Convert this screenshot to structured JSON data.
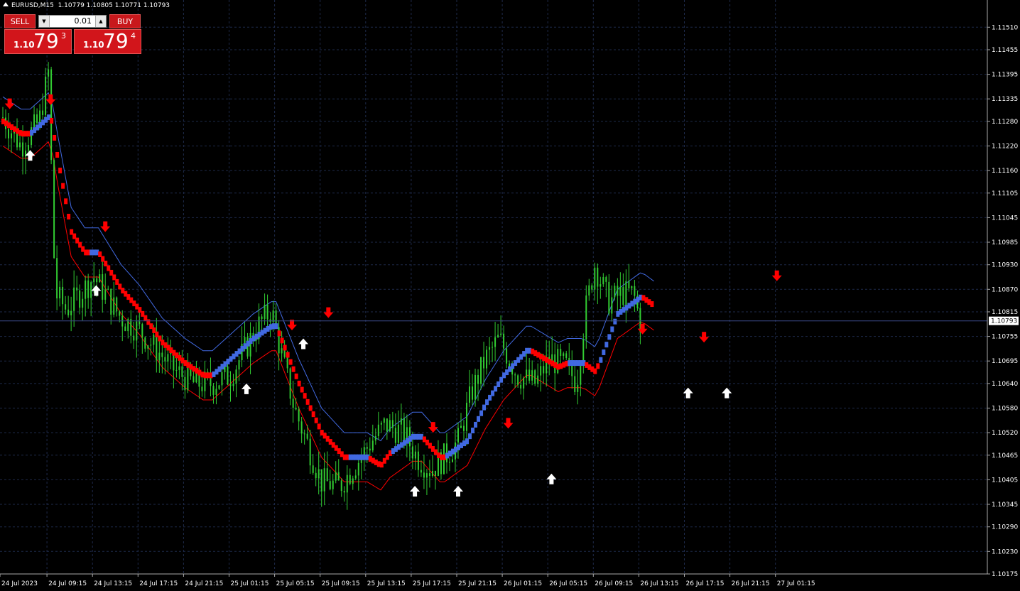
{
  "chart_header": {
    "symbol_text": "EURUSD,M15",
    "ohlc_text": "1.10779 1.10805 1.10771 1.10793"
  },
  "trade_panel": {
    "sell_label": "SELL",
    "buy_label": "BUY",
    "lot_value": "0.01",
    "sell_price": {
      "small": "1.10",
      "big": "79",
      "sup": "3"
    },
    "buy_price": {
      "small": "1.10",
      "big": "79",
      "sup": "4"
    }
  },
  "current_price_label": "1.10793",
  "colors": {
    "background": "#000000",
    "grid": "#1e2a4a",
    "candle": "#32cd32",
    "trend_up": "#4169e1",
    "trend_down": "#ff0000",
    "envelope_upper": "#4169e1",
    "envelope_lower": "#ff0000",
    "arrow_buy": "#ffffff",
    "arrow_sell": "#ff0000",
    "panel_red": "#c8181c"
  },
  "chart_data": {
    "type": "line",
    "symbol": "EURUSD",
    "timeframe": "M15",
    "ylim": [
      1.10175,
      1.1154
    ],
    "y_ticks": [
      "1.11510",
      "1.11455",
      "1.11395",
      "1.11335",
      "1.11280",
      "1.11220",
      "1.11160",
      "1.11105",
      "1.11045",
      "1.10985",
      "1.10930",
      "1.10870",
      "1.10815",
      "1.10755",
      "1.10695",
      "1.10640",
      "1.10580",
      "1.10520",
      "1.10465",
      "1.10405",
      "1.10345",
      "1.10290",
      "1.10230",
      "1.10175"
    ],
    "x_ticks": [
      "24 Jul 2023",
      "24 Jul 09:15",
      "24 Jul 13:15",
      "24 Jul 17:15",
      "24 Jul 21:15",
      "25 Jul 01:15",
      "25 Jul 05:15",
      "25 Jul 09:15",
      "25 Jul 13:15",
      "25 Jul 17:15",
      "25 Jul 21:15",
      "26 Jul 01:15",
      "26 Jul 05:15",
      "26 Jul 09:15",
      "26 Jul 13:15",
      "26 Jul 17:15",
      "26 Jul 21:15",
      "27 Jul 01:15"
    ],
    "current_price": 1.10793,
    "price_path": [
      [
        0,
        1.1129
      ],
      [
        0.4,
        1.1122
      ],
      [
        0.8,
        1.1128
      ],
      [
        1.0,
        1.114
      ],
      [
        1.15,
        1.1086
      ],
      [
        1.4,
        1.1082
      ],
      [
        1.7,
        1.1086
      ],
      [
        2.0,
        1.109
      ],
      [
        2.3,
        1.1085
      ],
      [
        2.6,
        1.108
      ],
      [
        3.0,
        1.1077
      ],
      [
        3.4,
        1.1072
      ],
      [
        3.8,
        1.1067
      ],
      [
        4.2,
        1.1064
      ],
      [
        4.6,
        1.1064
      ],
      [
        5.0,
        1.1066
      ],
      [
        5.3,
        1.1072
      ],
      [
        5.6,
        1.1078
      ],
      [
        5.9,
        1.1082
      ],
      [
        6.1,
        1.1072
      ],
      [
        6.4,
        1.1058
      ],
      [
        6.7,
        1.1049
      ],
      [
        7.0,
        1.104
      ],
      [
        7.4,
        1.1039
      ],
      [
        7.8,
        1.1045
      ],
      [
        8.1,
        1.105
      ],
      [
        8.4,
        1.1054
      ],
      [
        8.8,
        1.1052
      ],
      [
        9.1,
        1.1046
      ],
      [
        9.4,
        1.1043
      ],
      [
        9.7,
        1.1046
      ],
      [
        10.0,
        1.105
      ],
      [
        10.3,
        1.1062
      ],
      [
        10.6,
        1.107
      ],
      [
        10.9,
        1.1075
      ],
      [
        11.3,
        1.1066
      ],
      [
        11.7,
        1.1064
      ],
      [
        12.0,
        1.107
      ],
      [
        12.4,
        1.1068
      ],
      [
        12.6,
        1.1064
      ],
      [
        12.8,
        1.1082
      ],
      [
        13.0,
        1.1093
      ],
      [
        13.3,
        1.1084
      ],
      [
        13.6,
        1.1086
      ],
      [
        13.85,
        1.1086
      ],
      [
        14.0,
        1.1079
      ]
    ],
    "trend_line": [
      [
        0,
        1.1128,
        "down"
      ],
      [
        0.4,
        1.1125,
        "down"
      ],
      [
        0.6,
        1.1125,
        "up"
      ],
      [
        1.0,
        1.1129,
        "up"
      ],
      [
        1.05,
        1.1129,
        "down"
      ],
      [
        1.2,
        1.1119,
        "down"
      ],
      [
        1.5,
        1.1101,
        "down"
      ],
      [
        1.8,
        1.1096,
        "down"
      ],
      [
        1.9,
        1.1096,
        "up"
      ],
      [
        2.1,
        1.1096,
        "down"
      ],
      [
        2.6,
        1.1087,
        "down"
      ],
      [
        3.0,
        1.1082,
        "down"
      ],
      [
        3.5,
        1.1074,
        "down"
      ],
      [
        4.0,
        1.1069,
        "down"
      ],
      [
        4.4,
        1.1066,
        "down"
      ],
      [
        4.6,
        1.1066,
        "up"
      ],
      [
        5.0,
        1.107,
        "up"
      ],
      [
        5.5,
        1.1075,
        "up"
      ],
      [
        5.9,
        1.1078,
        "up"
      ],
      [
        6.0,
        1.1078,
        "down"
      ],
      [
        6.5,
        1.1064,
        "down"
      ],
      [
        7.0,
        1.1052,
        "down"
      ],
      [
        7.5,
        1.1046,
        "down"
      ],
      [
        7.6,
        1.1046,
        "up"
      ],
      [
        8.0,
        1.1046,
        "down"
      ],
      [
        8.3,
        1.1044,
        "down"
      ],
      [
        8.5,
        1.1047,
        "up"
      ],
      [
        9.0,
        1.1051,
        "up"
      ],
      [
        9.2,
        1.1051,
        "down"
      ],
      [
        9.6,
        1.1046,
        "down"
      ],
      [
        9.7,
        1.1046,
        "up"
      ],
      [
        10.2,
        1.105,
        "up"
      ],
      [
        10.6,
        1.1059,
        "up"
      ],
      [
        11.0,
        1.1066,
        "up"
      ],
      [
        11.5,
        1.1072,
        "up"
      ],
      [
        11.6,
        1.1072,
        "down"
      ],
      [
        12.2,
        1.1068,
        "down"
      ],
      [
        12.4,
        1.1069,
        "up"
      ],
      [
        12.7,
        1.1069,
        "up"
      ],
      [
        12.75,
        1.1069,
        "down"
      ],
      [
        13.0,
        1.1067,
        "down"
      ],
      [
        13.1,
        1.1069,
        "up"
      ],
      [
        13.5,
        1.1081,
        "up"
      ],
      [
        14.0,
        1.1085,
        "up"
      ],
      [
        14.05,
        1.1085,
        "down"
      ],
      [
        14.3,
        1.1083,
        "down"
      ]
    ],
    "buy_arrows": [
      [
        0.6,
        1.1121
      ],
      [
        2.05,
        1.1088
      ],
      [
        5.35,
        1.1064
      ],
      [
        6.6,
        1.1075
      ],
      [
        9.05,
        1.1039
      ],
      [
        10.0,
        1.1039
      ],
      [
        12.05,
        1.1042
      ],
      [
        15.05,
        1.1063
      ],
      [
        15.9,
        1.1063
      ]
    ],
    "sell_arrows": [
      [
        0.15,
        1.1131
      ],
      [
        1.05,
        1.1132
      ],
      [
        2.25,
        1.1101
      ],
      [
        6.35,
        1.1077
      ],
      [
        7.15,
        1.108
      ],
      [
        9.45,
        1.1052
      ],
      [
        11.1,
        1.1053
      ],
      [
        14.05,
        1.1076
      ],
      [
        15.4,
        1.1074
      ],
      [
        17.0,
        1.1089
      ]
    ]
  }
}
